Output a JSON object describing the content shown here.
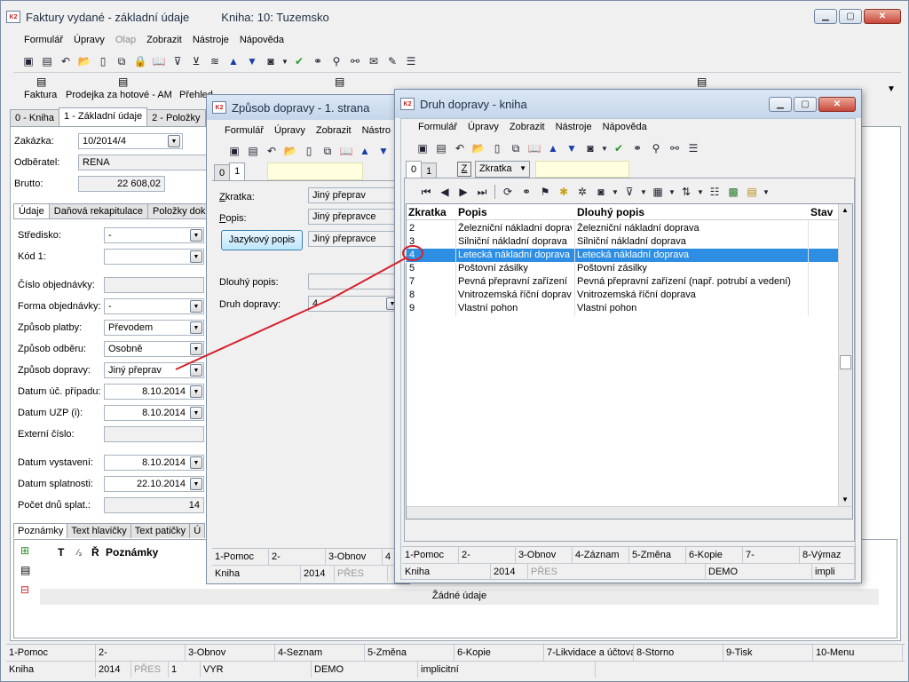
{
  "main": {
    "title": "Faktury vydané - základní údaje",
    "book": "Kniha: 10: Tuzemsko",
    "menu": [
      "Formulář",
      "Úpravy",
      "Olap",
      "Zobrazit",
      "Nástroje",
      "Nápověda"
    ],
    "reports": [
      "Faktura",
      "Prodejka za hotové - AM",
      "Přehled"
    ],
    "tabs": [
      "0 - Kniha",
      "1 - Základní údaje",
      "2 - Položky"
    ],
    "header_labels": {
      "zakazka": "Zakázka:",
      "odberatel": "Odběratel:",
      "brutto": "Brutto:"
    },
    "header_values": {
      "zakazka": "10/2014/4",
      "odberatel": "RENA",
      "brutto": "22 608,02"
    },
    "subtabs": [
      "Údaje",
      "Daňová rekapitulace",
      "Položky dokla"
    ],
    "fields": [
      {
        "label": "Středisko:",
        "value": "-"
      },
      {
        "label": "Kód 1:",
        "value": ""
      },
      {
        "label": "Číslo objednávky:",
        "value": ""
      },
      {
        "label": "Forma objednávky:",
        "value": "-"
      },
      {
        "label": "Způsob platby:",
        "value": "Převodem"
      },
      {
        "label": "Způsob odběru:",
        "value": "Osobně"
      },
      {
        "label": "Způsob dopravy:",
        "value": "Jiný přeprav"
      },
      {
        "label": "Datum úč. případu:",
        "value": "8.10.2014"
      },
      {
        "label": "Datum UZP (i):",
        "value": "8.10.2014"
      },
      {
        "label": "Externí číslo:",
        "value": ""
      },
      {
        "label": "Datum vystavení:",
        "value": "8.10.2014"
      },
      {
        "label": "Datum splatnosti:",
        "value": "22.10.2014"
      },
      {
        "label": "Počet dnů splat.:",
        "value": "14"
      }
    ],
    "bottom_tabs": [
      "Poznámky",
      "Text hlavičky",
      "Text patičky",
      "Ú"
    ],
    "notes_header": {
      "t": "T",
      "sort": "⁄₃",
      "r": "Ř",
      "title": "Poznámky"
    },
    "no_data": "Žádné údaje",
    "fkeys": [
      "1-Pomoc",
      "2-",
      "3-Obnov",
      "4-Seznam",
      "5-Změna",
      "6-Kopie",
      "7-Likvidace a účtová",
      "8-Storno",
      "9-Tisk",
      "10-Menu"
    ],
    "status": [
      "Kniha",
      "2014",
      "PŘES",
      "1",
      "VYR",
      "DEMO",
      "implicitní"
    ]
  },
  "zpusob": {
    "title": "Způsob dopravy - 1. strana",
    "menu": [
      "Formulář",
      "Úpravy",
      "Zobrazit",
      "Nástro"
    ],
    "tabs": [
      "0",
      "1"
    ],
    "labels": {
      "zkratka": "Zkratka:",
      "popis": "Popis:",
      "dlouhy": "Dlouhý popis:",
      "druh": "Druh dopravy:"
    },
    "values": {
      "zkratka": "Jiný přeprav",
      "popis": "Jiný přeprav ce",
      "dlouhy_btn_val": "Jiný přepravce",
      "druh": "4"
    },
    "jazykovy_btn": "Jazykový popis",
    "fkeys": [
      "1-Pomoc",
      "2-",
      "3-Obnov",
      "4"
    ],
    "status": [
      "Kniha",
      "2014",
      "PŘES"
    ]
  },
  "druh": {
    "title": "Druh dopravy - kniha",
    "menu": [
      "Formulář",
      "Úpravy",
      "Zobrazit",
      "Nástroje",
      "Nápověda"
    ],
    "tabs": [
      "0",
      "1"
    ],
    "key_btn": "Z",
    "sort_select": "Zkratka",
    "columns": [
      "Zkratka",
      "Popis",
      "Dlouhý popis",
      "Stav"
    ],
    "rows": [
      {
        "zkratka": "2",
        "popis": "Železniční nákladní doprava",
        "dlouhy": "Železniční nákladní doprava"
      },
      {
        "zkratka": "3",
        "popis": "Silniční nákladní doprava",
        "dlouhy": "Silniční nákladní doprava"
      },
      {
        "zkratka": "4",
        "popis": "Letecká nákladní doprava",
        "dlouhy": "Letecká nákladní doprava"
      },
      {
        "zkratka": "5",
        "popis": "Poštovní zásilky",
        "dlouhy": "Poštovní zásilky"
      },
      {
        "zkratka": "7",
        "popis": "Pevná přepravní zařízení",
        "dlouhy": "Pevná přepravní zařízení (např. potrubí a vedení)"
      },
      {
        "zkratka": "8",
        "popis": "Vnitrozemská říční doprava",
        "dlouhy": "Vnitrozemská říční doprava"
      },
      {
        "zkratka": "9",
        "popis": "Vlastní pohon",
        "dlouhy": "Vlastní pohon"
      }
    ],
    "selected_row": 2,
    "fkeys": [
      "1-Pomoc",
      "2-",
      "3-Obnov",
      "4-Záznam",
      "5-Změna",
      "6-Kopie",
      "7-",
      "8-Výmaz"
    ],
    "status": [
      "Kniha",
      "2014",
      "PŘES",
      "DEMO",
      "impli"
    ]
  },
  "colors": {
    "selection": "#2d8ee3",
    "annotation": "#d6202a"
  }
}
